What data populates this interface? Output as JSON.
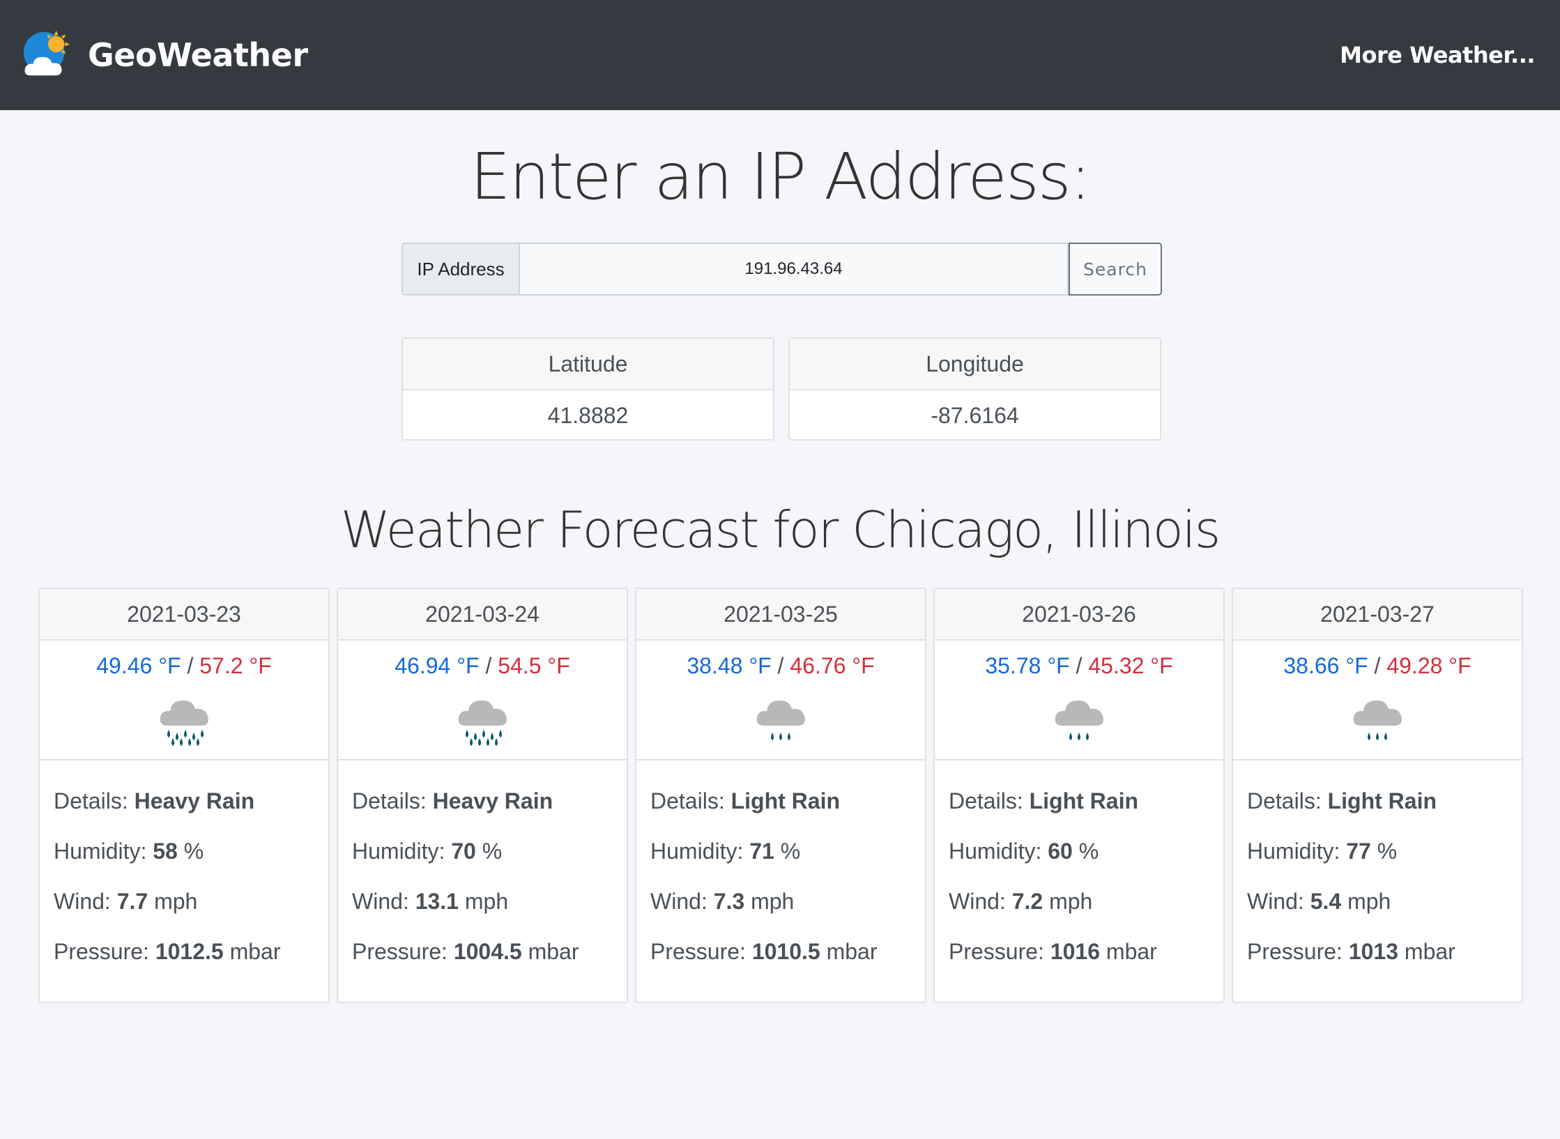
{
  "navbar": {
    "brand": "GeoWeather",
    "more_link": "More Weather..."
  },
  "header": {
    "title": "Enter an IP Address:"
  },
  "search": {
    "label": "IP Address",
    "value": "191.96.43.64",
    "button": "Search"
  },
  "coords": {
    "latitude_label": "Latitude",
    "latitude": "41.8882",
    "longitude_label": "Longitude",
    "longitude": "-87.6164"
  },
  "forecast": {
    "title": "Weather Forecast for Chicago, Illinois",
    "labels": {
      "details": "Details:",
      "humidity": "Humidity:",
      "wind": "Wind:",
      "pressure": "Pressure:",
      "humidity_unit": "%",
      "wind_unit": "mph",
      "pressure_unit": "mbar",
      "slash": "/"
    },
    "days": [
      {
        "date": "2021-03-23",
        "low": "49.46 °F",
        "high": "57.2 °F",
        "icon": "heavy-rain-icon",
        "details": "Heavy Rain",
        "humidity": "58",
        "wind": "7.7",
        "pressure": "1012.5"
      },
      {
        "date": "2021-03-24",
        "low": "46.94 °F",
        "high": "54.5 °F",
        "icon": "heavy-rain-icon",
        "details": "Heavy Rain",
        "humidity": "70",
        "wind": "13.1",
        "pressure": "1004.5"
      },
      {
        "date": "2021-03-25",
        "low": "38.48 °F",
        "high": "46.76 °F",
        "icon": "light-rain-icon",
        "details": "Light Rain",
        "humidity": "71",
        "wind": "7.3",
        "pressure": "1010.5"
      },
      {
        "date": "2021-03-26",
        "low": "35.78 °F",
        "high": "45.32 °F",
        "icon": "light-rain-icon",
        "details": "Light Rain",
        "humidity": "60",
        "wind": "7.2",
        "pressure": "1016"
      },
      {
        "date": "2021-03-27",
        "low": "38.66 °F",
        "high": "49.28 °F",
        "icon": "light-rain-icon",
        "details": "Light Rain",
        "humidity": "77",
        "wind": "5.4",
        "pressure": "1013"
      }
    ]
  },
  "colors": {
    "navbar": "#343a40",
    "low_temp": "#1469d9",
    "high_temp": "#d42d3c",
    "raindrop": "#0e5a6e",
    "cloud": "#b8b8b8"
  }
}
